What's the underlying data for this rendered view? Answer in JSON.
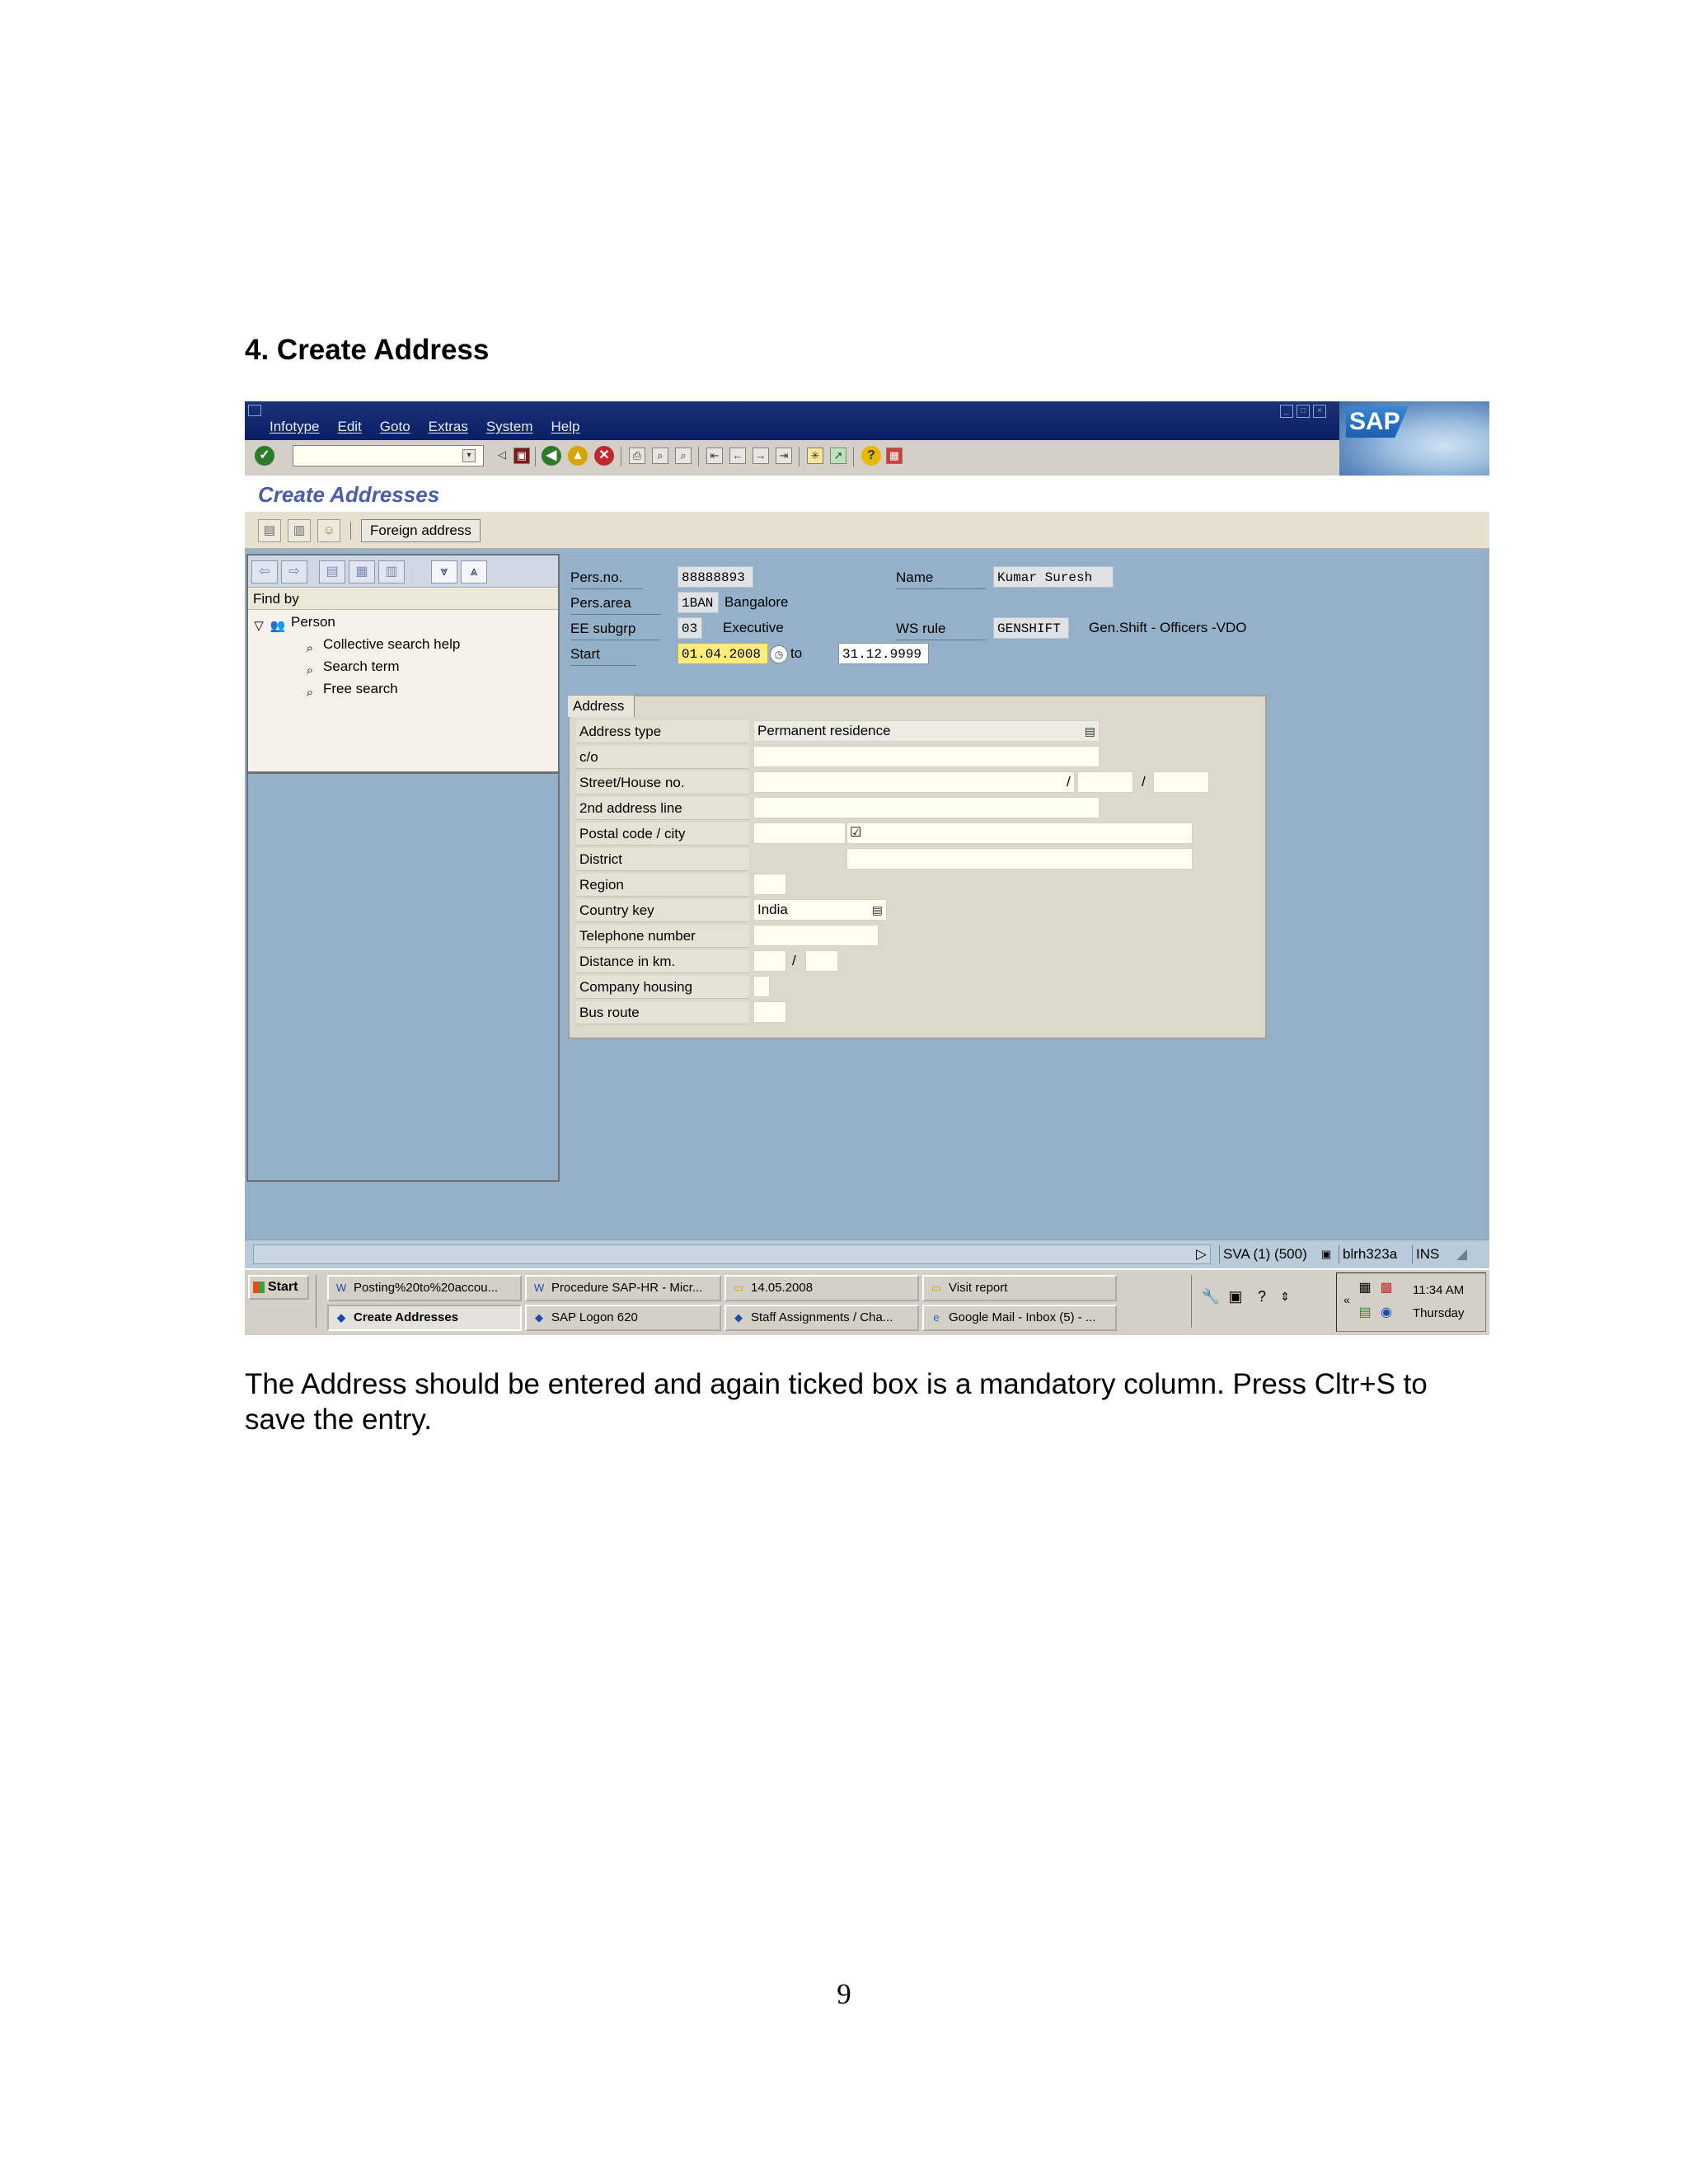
{
  "document": {
    "heading": "4. Create Address",
    "caption": "The Address should be entered and again ticked box is a mandatory column. Press Cltr+S to save the entry.",
    "page_number": "9"
  },
  "sap_logo": "SAP",
  "menu": [
    "Infotype",
    "Edit",
    "Goto",
    "Extras",
    "System",
    "Help"
  ],
  "toolbar": {
    "command_field_value": "",
    "icons": [
      "enter-icon",
      "dropdown-icon",
      "back-icon",
      "save-icon",
      "exit-icon",
      "cancel-icon",
      "print-icon",
      "find-icon",
      "first-page-icon",
      "last-page-icon",
      "new-session-icon",
      "shortcut-icon",
      "help-icon",
      "layout-icon"
    ]
  },
  "screen_title": "Create Addresses",
  "app_toolbar": {
    "foreign_address_button": "Foreign address"
  },
  "nav": {
    "find_by": "Find by",
    "person": "Person",
    "items": [
      "Collective search help",
      "Search term",
      "Free search"
    ]
  },
  "header": {
    "pers_no_label": "Pers.no.",
    "pers_no": "88888893",
    "name_label": "Name",
    "name": "Kumar Suresh",
    "pers_area_label": "Pers.area",
    "pers_area_code": "1BAN",
    "pers_area_text": "Bangalore",
    "ee_subgrp_label": "EE subgrp",
    "ee_subgrp_code": "03",
    "ee_subgrp_text": "Executive",
    "ws_rule_label": "WS rule",
    "ws_rule_code": "GENSHIFT",
    "ws_rule_text": "Gen.Shift - Officers -VDO",
    "start_label": "Start",
    "start": "01.04.2008",
    "to_label": "to",
    "end": "31.12.9999"
  },
  "address": {
    "group_title": "Address",
    "address_type_label": "Address type",
    "address_type_value": "Permanent residence",
    "co_label": "c/o",
    "street_label": "Street/House no.",
    "line2_label": "2nd address line",
    "postal_label": "Postal code / city",
    "postal_required_mark": "☑",
    "district_label": "District",
    "region_label": "Region",
    "country_label": "Country key",
    "country_value": "India",
    "telephone_label": "Telephone number",
    "distance_label": "Distance in km.",
    "housing_label": "Company housing",
    "bus_label": "Bus route",
    "slash": "/"
  },
  "status": {
    "system": "SVA (1) (500)",
    "server": "blrh323a",
    "mode": "INS"
  },
  "taskbar": {
    "start": "Start",
    "row1": [
      "Posting%20to%20accou...",
      "Procedure SAP-HR - Micr...",
      "14.05.2008",
      "Visit report"
    ],
    "row2": [
      "Create Addresses",
      "SAP Logon 620",
      "Staff Assignments / Cha...",
      "Google Mail - Inbox (5) - ..."
    ],
    "time": "11:34 AM",
    "day": "Thursday"
  },
  "colors": {
    "title_bar": "#0b1f66",
    "screen_background": "#94b1c9",
    "required_field": "#ffec7a",
    "screen_title_text": "#4a5ea8"
  }
}
